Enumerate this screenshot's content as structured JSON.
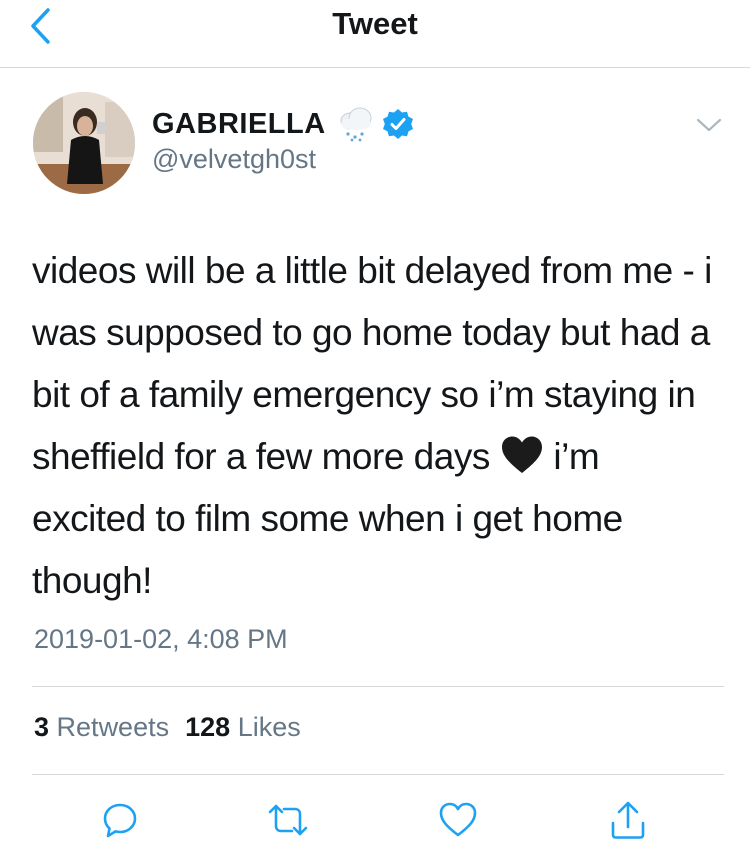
{
  "nav": {
    "title": "Tweet",
    "back_icon": "chevron-left-icon"
  },
  "author": {
    "name": "GABRIELLA",
    "handle": "@velvetgh0st",
    "badge_icon": "cloud-snow-emoji-icon",
    "verified_icon": "verified-badge-icon"
  },
  "tweet": {
    "text_before_heart": "videos will be a little bit delayed from me - i was supposed to go home today but had a bit of a family emergency so i’m staying in sheffield for a few more days ",
    "heart_emoji": "black-heart-icon",
    "text_after_heart": " i’m excited to film some when i get home though!",
    "timestamp": "2019-01-02, 4:08 PM"
  },
  "stats": {
    "retweets_count": "3",
    "retweets_label": "Retweets",
    "likes_count": "128",
    "likes_label": "Likes"
  },
  "actions": [
    "reply-icon",
    "retweet-icon",
    "like-icon",
    "share-icon"
  ],
  "colors": {
    "accent": "#1da1f2",
    "secondary_text": "#657786",
    "divider": "#d6d9dc"
  }
}
